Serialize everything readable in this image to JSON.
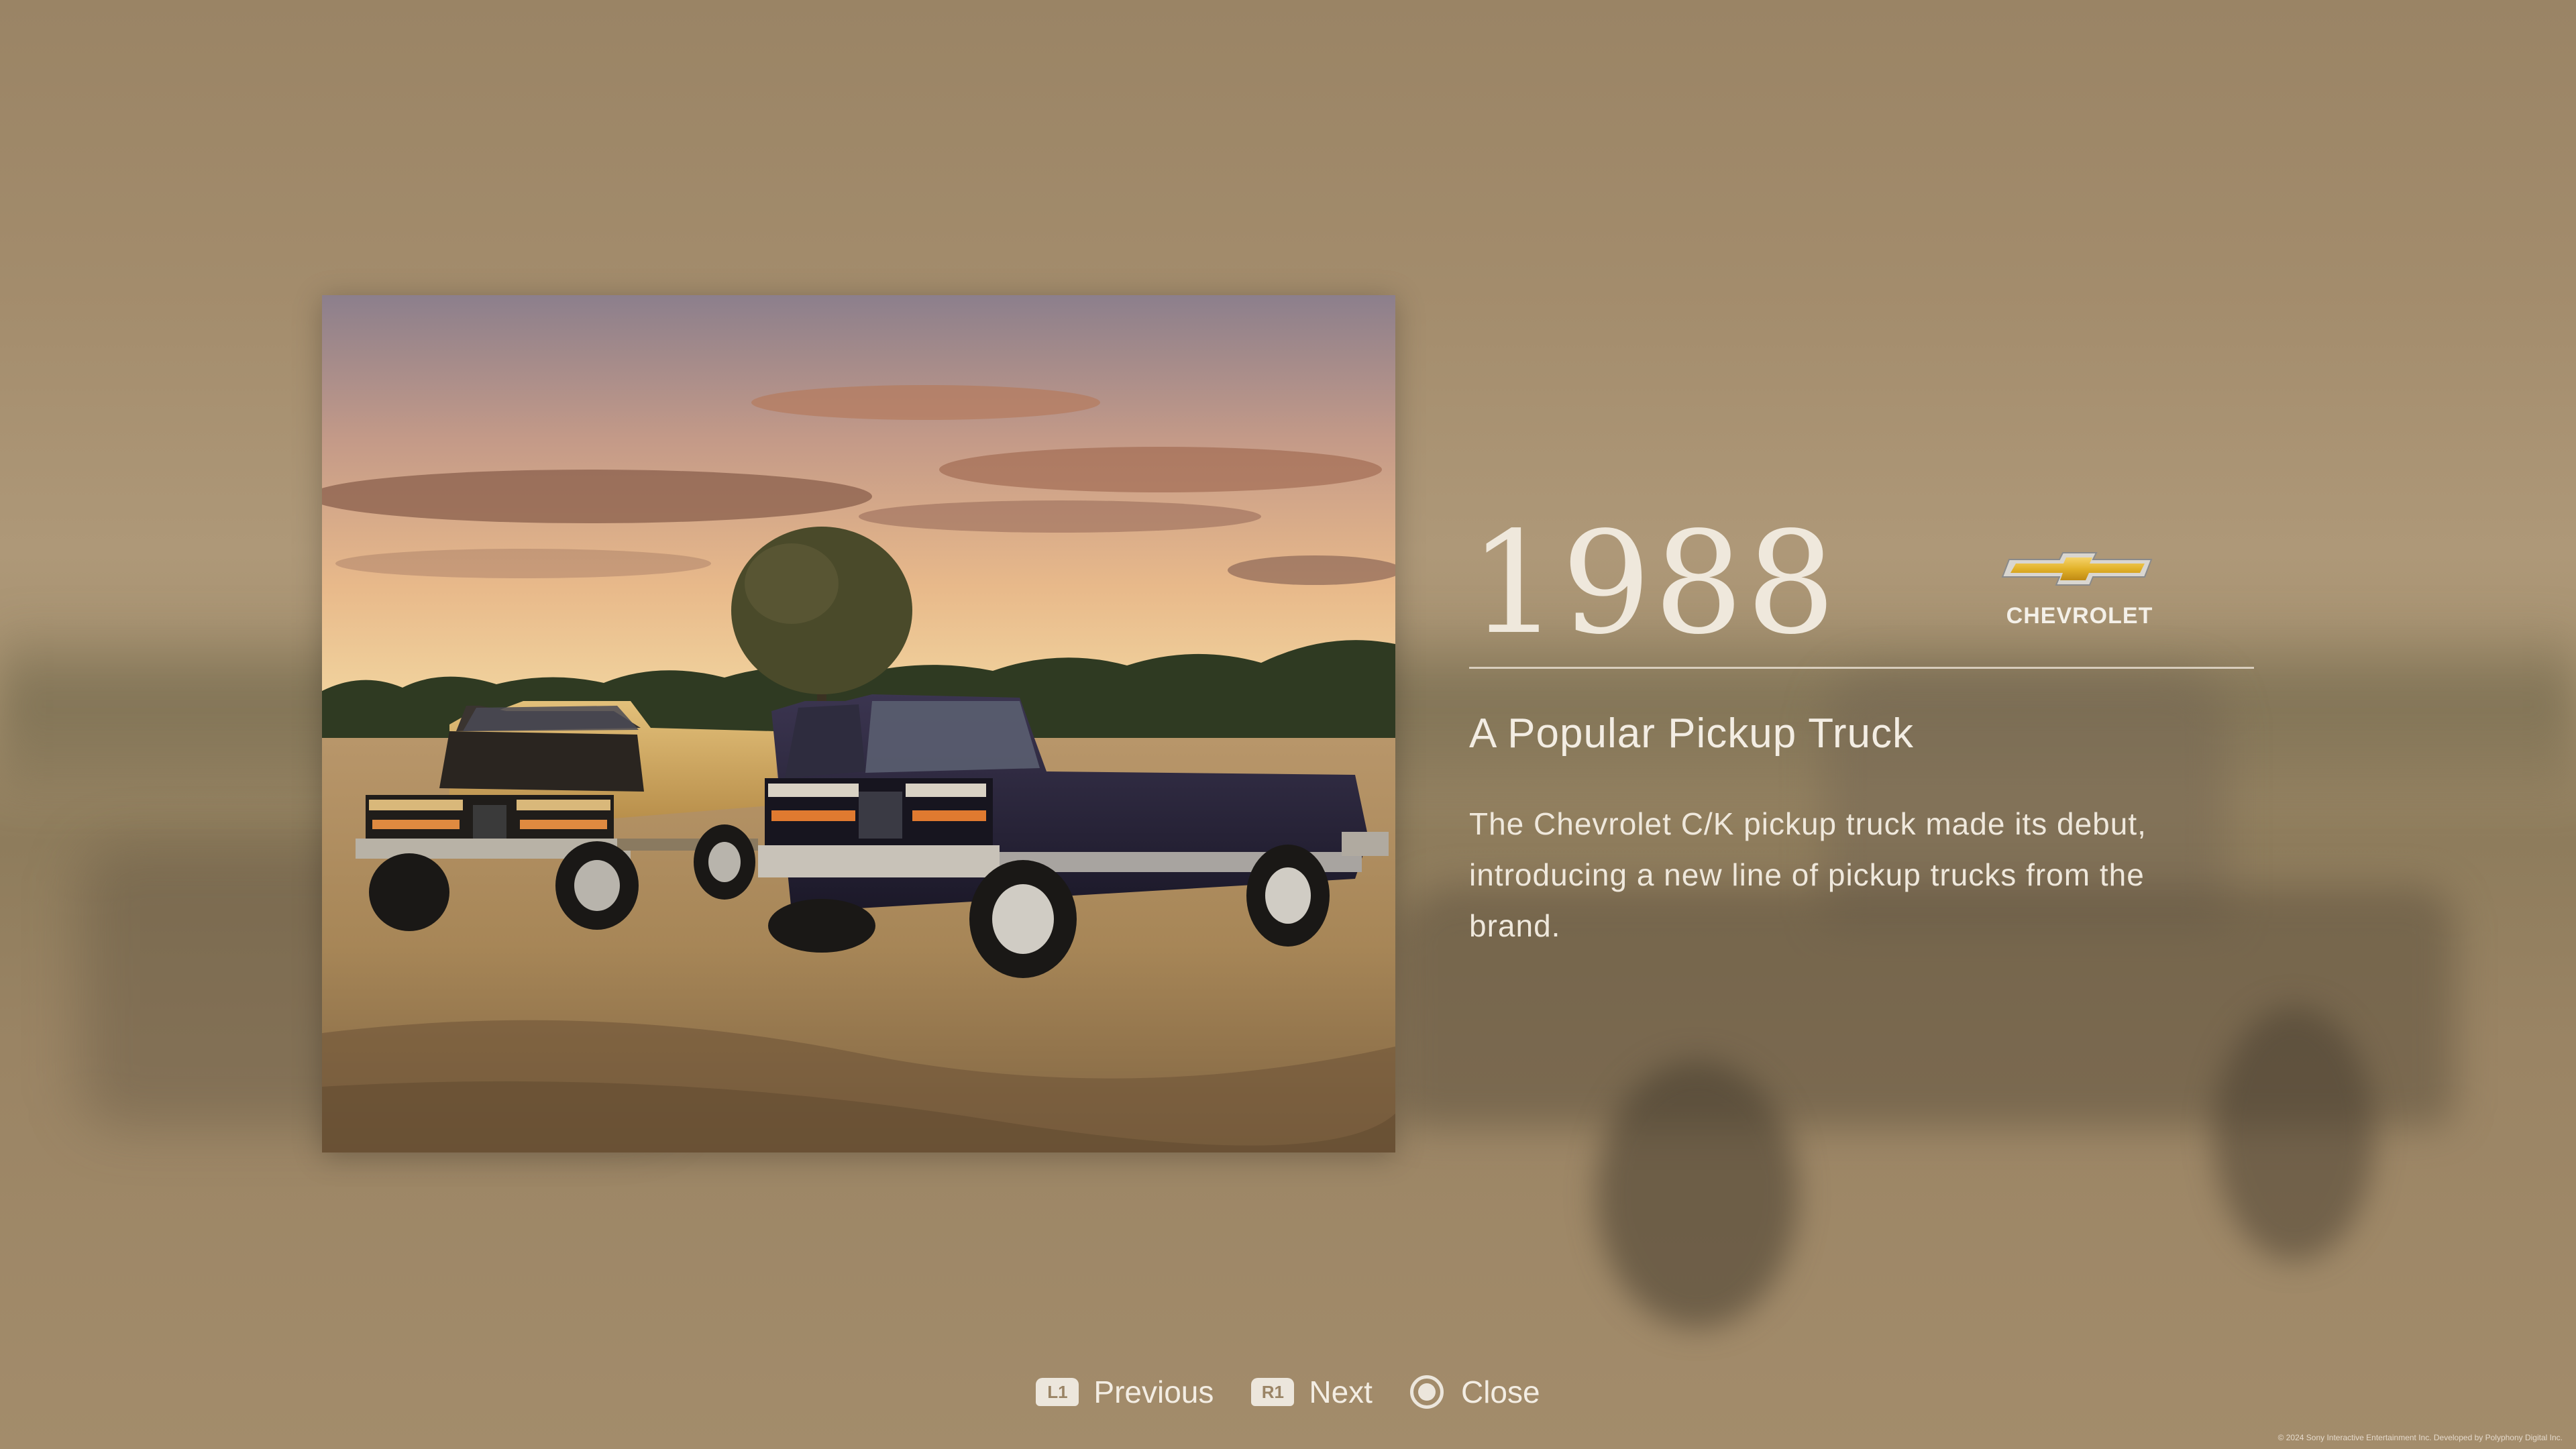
{
  "year": "1988",
  "brand": {
    "name": "CHEVROLET",
    "logo_icon": "chevrolet-bowtie-icon",
    "logo_color": "#e8b92a"
  },
  "headline": "A Popular Pickup Truck",
  "description": "The Chevrolet C/K pickup truck made its debut, introducing a new line of pickup trucks from the brand.",
  "controls": {
    "previous": {
      "badge": "L1",
      "label": "Previous"
    },
    "next": {
      "badge": "R1",
      "label": "Next"
    },
    "close": {
      "icon": "circle-button-icon",
      "label": "Close"
    }
  },
  "copyright": "© 2024 Sony Interactive Entertainment Inc. Developed by Polyphony Digital Inc.",
  "colors": {
    "background": "#9c8666",
    "text": "#efe8dc"
  }
}
